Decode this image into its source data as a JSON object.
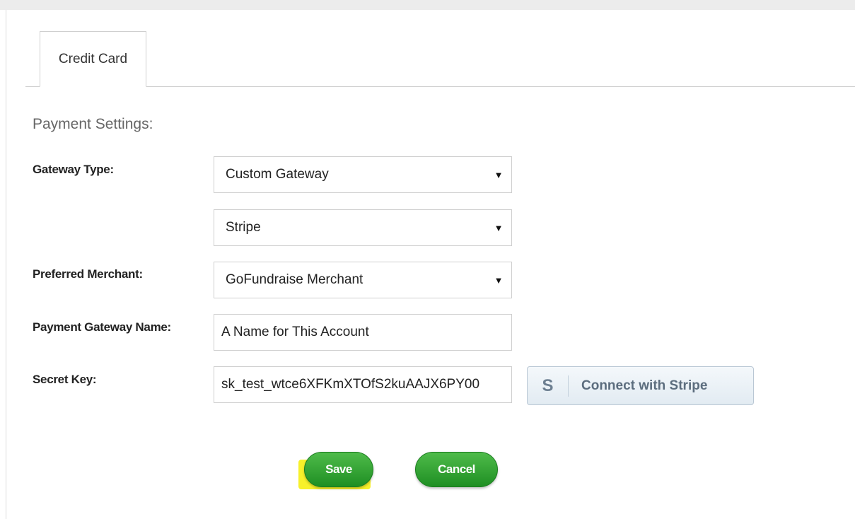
{
  "tabs": [
    {
      "label": "Credit Card"
    }
  ],
  "section_title": "Payment Settings:",
  "form": {
    "gateway_type": {
      "label": "Gateway Type:",
      "value": "Custom Gateway"
    },
    "gateway_provider": {
      "value": "Stripe"
    },
    "preferred_merchant": {
      "label": "Preferred Merchant:",
      "value": "GoFundraise Merchant"
    },
    "payment_gateway_name": {
      "label": "Payment Gateway Name:",
      "value": "A Name for This Account"
    },
    "secret_key": {
      "label": "Secret Key:",
      "value": "sk_test_wtce6XFKmXTOfS2kuAAJX6PY00"
    }
  },
  "stripe_button": {
    "icon_letter": "S",
    "label": "Connect with Stripe"
  },
  "actions": {
    "save_label": "Save",
    "cancel_label": "Cancel"
  },
  "colors": {
    "button_green": "#2e9e2f",
    "highlight_yellow": "#f7f12a",
    "stripe_text": "#5c6d7e"
  }
}
